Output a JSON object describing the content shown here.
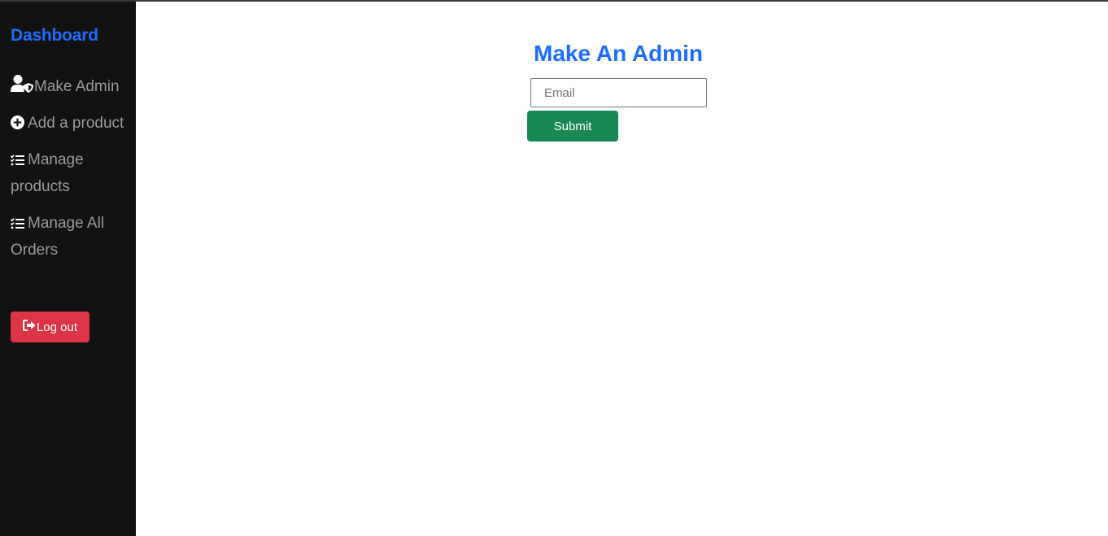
{
  "sidebar": {
    "brand": "Dashboard",
    "items": [
      {
        "label": "Make Admin",
        "icon": "user-shield-icon"
      },
      {
        "label": "Add a product",
        "icon": "plus-circle-icon"
      },
      {
        "label": "Manage products",
        "icon": "tasks-icon"
      },
      {
        "label": "Manage All Orders",
        "icon": "tasks-icon"
      }
    ],
    "logout": {
      "label": "Log out",
      "icon": "sign-out-icon"
    }
  },
  "main": {
    "title": "Make An Admin",
    "email_placeholder": "Email",
    "email_value": "",
    "submit_label": "Submit"
  },
  "colors": {
    "sidebar_bg": "#121212",
    "brand": "#1a6dff",
    "nav_text": "#9a9a9a",
    "logout": "#dc3545",
    "submit": "#198754"
  }
}
